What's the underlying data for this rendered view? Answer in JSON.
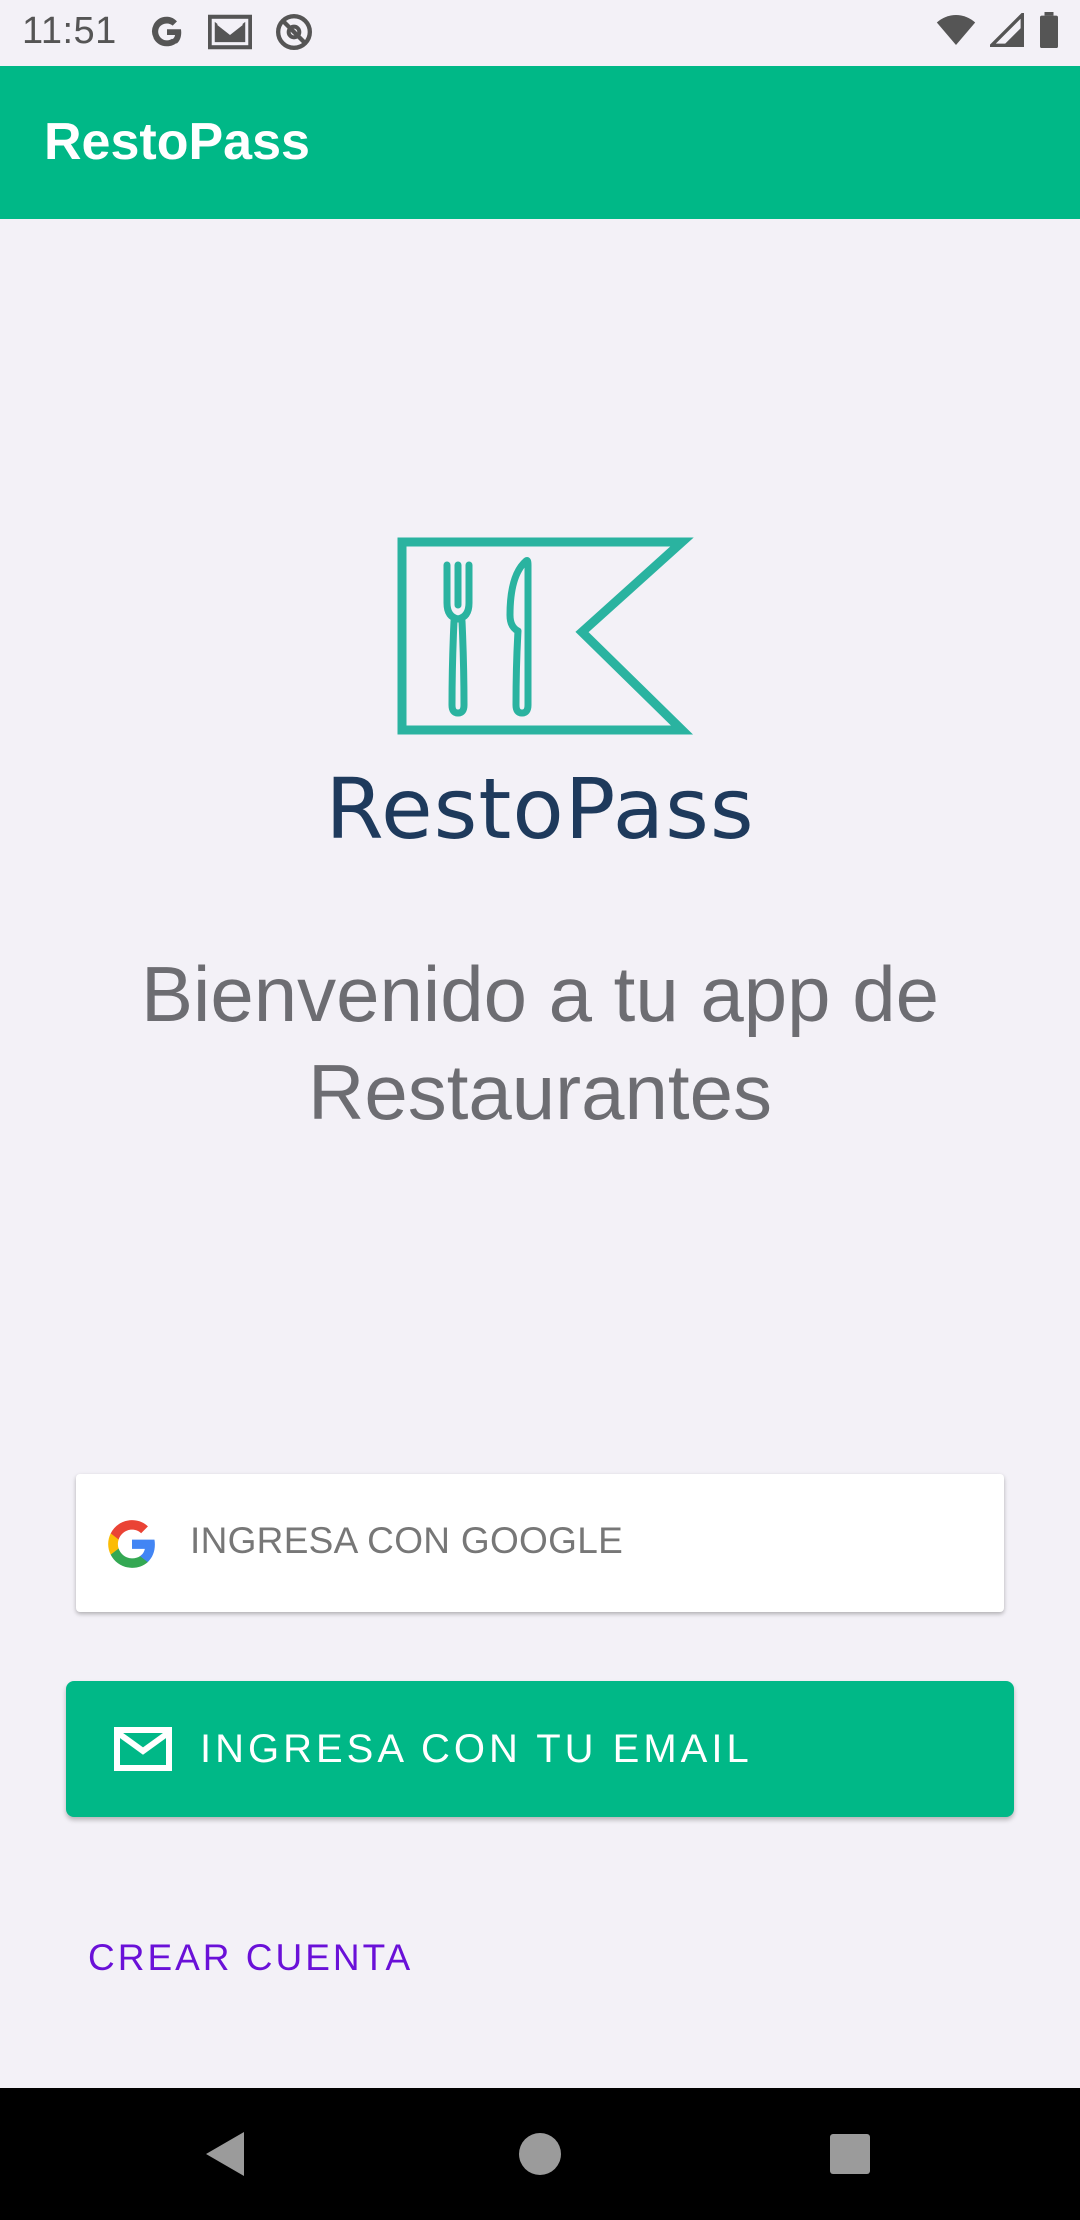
{
  "status_bar": {
    "time": "11:51",
    "left_icons": [
      "google-notification-icon",
      "gmail-notification-icon",
      "vpn-key-icon"
    ],
    "right_icons": [
      "wifi-icon",
      "cell-signal-icon",
      "battery-icon"
    ]
  },
  "app_bar": {
    "title": "RestoPass"
  },
  "logo": {
    "wordmark": "RestoPass",
    "icon": "restaurant-flag-icon",
    "color": "#2ab3a0",
    "wordmark_color": "#1e3a5c"
  },
  "welcome": {
    "text": "Bienvenido a tu app de Restaurantes"
  },
  "buttons": {
    "google_label": "INGRESA CON GOOGLE",
    "email_label": "INGRESA CON TU EMAIL",
    "create_account_label": "CREAR CUENTA"
  },
  "colors": {
    "primary": "#00b887",
    "background": "#f3f1f7",
    "link": "#6a10d8"
  },
  "nav": {
    "icons": [
      "back-icon",
      "home-icon",
      "recents-icon"
    ]
  }
}
